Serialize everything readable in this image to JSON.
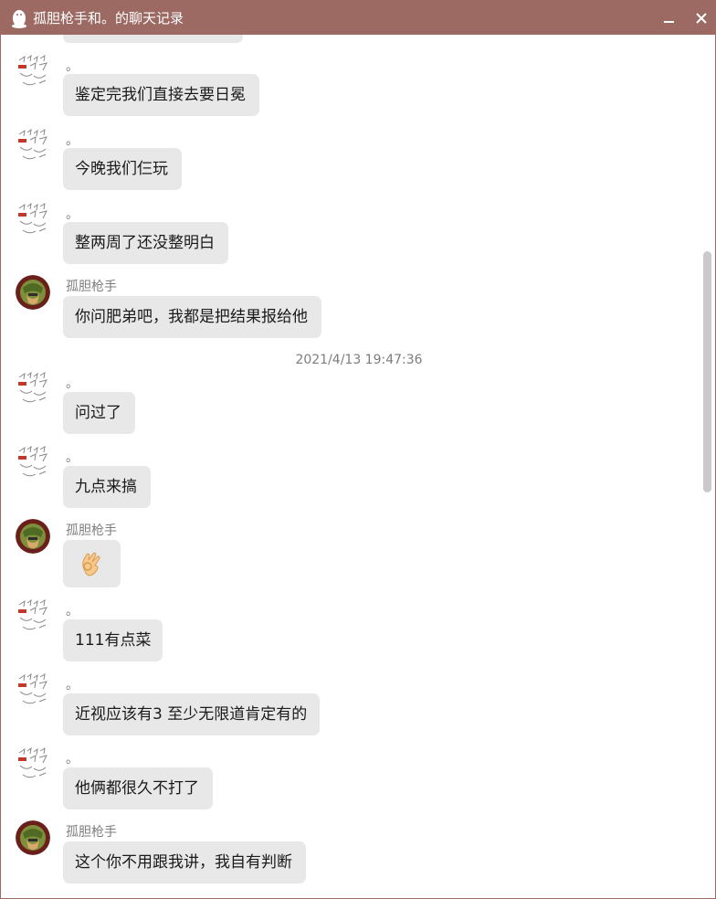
{
  "window": {
    "title": "孤胆枪手和。的聊天记录",
    "titlebar_color": "#9c6a63",
    "minimize_label": "—",
    "close_label": "✕"
  },
  "chat": {
    "bubble_color": "#e8e8e8",
    "timestamp": "2021/4/13 19:47:36",
    "messages": [
      {
        "sender": "。",
        "avatar": "sketch-avatar",
        "text": "鉴定完我们直接去要日冕"
      },
      {
        "sender": "。",
        "avatar": "sketch-avatar",
        "text": "今晚我们仨玩"
      },
      {
        "sender": "。",
        "avatar": "sketch-avatar",
        "text": "整两周了还没整明白"
      },
      {
        "sender": "孤胆枪手",
        "avatar": "soldier-avatar",
        "text": "你问肥弟吧，我都是把结果报给他"
      },
      {
        "sender": "。",
        "avatar": "sketch-avatar",
        "text": "问过了"
      },
      {
        "sender": "。",
        "avatar": "sketch-avatar",
        "text": "九点来搞"
      },
      {
        "sender": "孤胆枪手",
        "avatar": "soldier-avatar",
        "text": "",
        "emoji": "ok-hand-emoji"
      },
      {
        "sender": "。",
        "avatar": "sketch-avatar",
        "text": "111有点菜"
      },
      {
        "sender": "。",
        "avatar": "sketch-avatar",
        "text": "近视应该有3 至少无限道肯定有的"
      },
      {
        "sender": "。",
        "avatar": "sketch-avatar",
        "text": "他俩都很久不打了"
      },
      {
        "sender": "孤胆枪手",
        "avatar": "soldier-avatar",
        "text": "这个你不用跟我讲，我自有判断"
      }
    ]
  }
}
